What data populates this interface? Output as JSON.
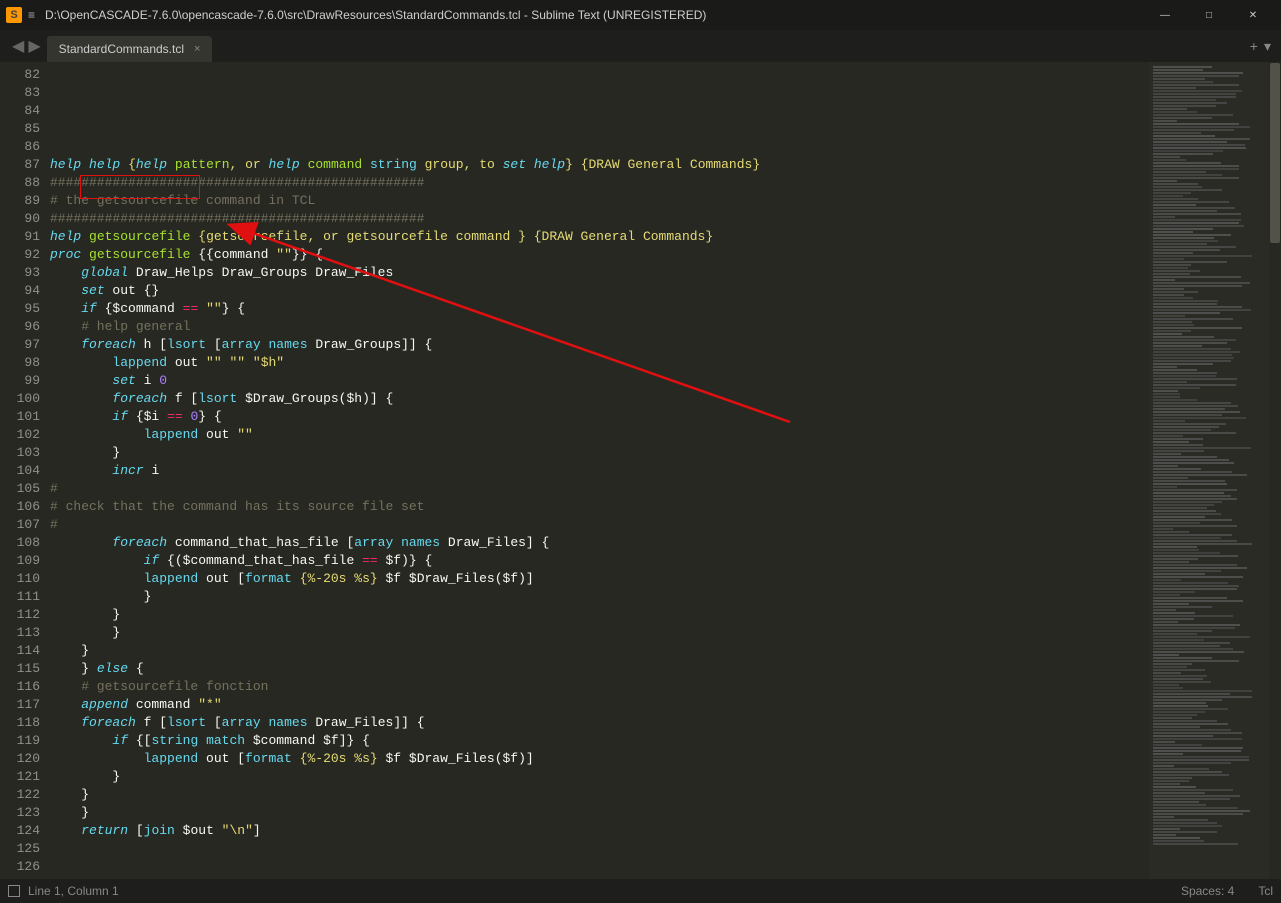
{
  "window": {
    "title": "D:\\OpenCASCADE-7.6.0\\opencascade-7.6.0\\src\\DrawResources\\StandardCommands.tcl - Sublime Text (UNREGISTERED)",
    "minimize": "—",
    "maximize": "□",
    "close": "✕"
  },
  "tab": {
    "name": "StandardCommands.tcl",
    "close": "×"
  },
  "nav": {
    "back": "◀",
    "forward": "▶",
    "plus": "+",
    "dropdown": "▾"
  },
  "lines": {
    "start": 82,
    "count": 46
  },
  "code": {
    "l82": "help help {help pattern, or help command string group, to set help} {DRAW General Commands}",
    "l83": "################################################",
    "l84": "# the getsourcefile command in TCL",
    "l85": "################################################",
    "l86": "",
    "l87": "help getsourcefile {getsourcefile, or getsourcefile command } {DRAW General Commands}",
    "l88": "",
    "l89": "proc getsourcefile {{command \"\"}} {",
    "l90": "",
    "l91": "    global Draw_Helps Draw_Groups Draw_Files",
    "l92": "",
    "l93": "    set out {}",
    "l94": "    if {$command == \"\"} {",
    "l95": "",
    "l96": "    # help general",
    "l97": "    foreach h [lsort [array names Draw_Groups]] {",
    "l98": "        lappend out \"\" \"\" \"$h\"",
    "l99": "        set i 0",
    "l100": "        foreach f [lsort $Draw_Groups($h)] {",
    "l101": "        if {$i == 0} {",
    "l102": "            lappend out \"\"",
    "l103": "        }",
    "l104": "        incr i",
    "l105": "#",
    "l106": "# check that the command has its source file set",
    "l107": "#",
    "l108": "        foreach command_that_has_file [array names Draw_Files] {",
    "l109": "            if {($command_that_has_file == $f)} {",
    "l110": "            lappend out [format {%-20s %s} $f $Draw_Files($f)]",
    "l111": "            }",
    "l112": "        }",
    "l113": "        }",
    "l114": "    }",
    "l115": "    } else {",
    "l116": "",
    "l117": "    # getsourcefile fonction",
    "l118": "    append command \"*\"",
    "l119": "    foreach f [lsort [array names Draw_Files]] {",
    "l120": "        if {[string match $command $f]} {",
    "l121": "            lappend out [format {%-20s %s} $f $Draw_Files($f)]",
    "l122": "        }",
    "l123": "    }",
    "l124": "",
    "l125": "    } ",
    "l126": "    return [join $out \"\\n\"]"
  },
  "status": {
    "position": "Line 1, Column 1",
    "spaces": "Spaces: 4",
    "lang": "Tcl"
  }
}
